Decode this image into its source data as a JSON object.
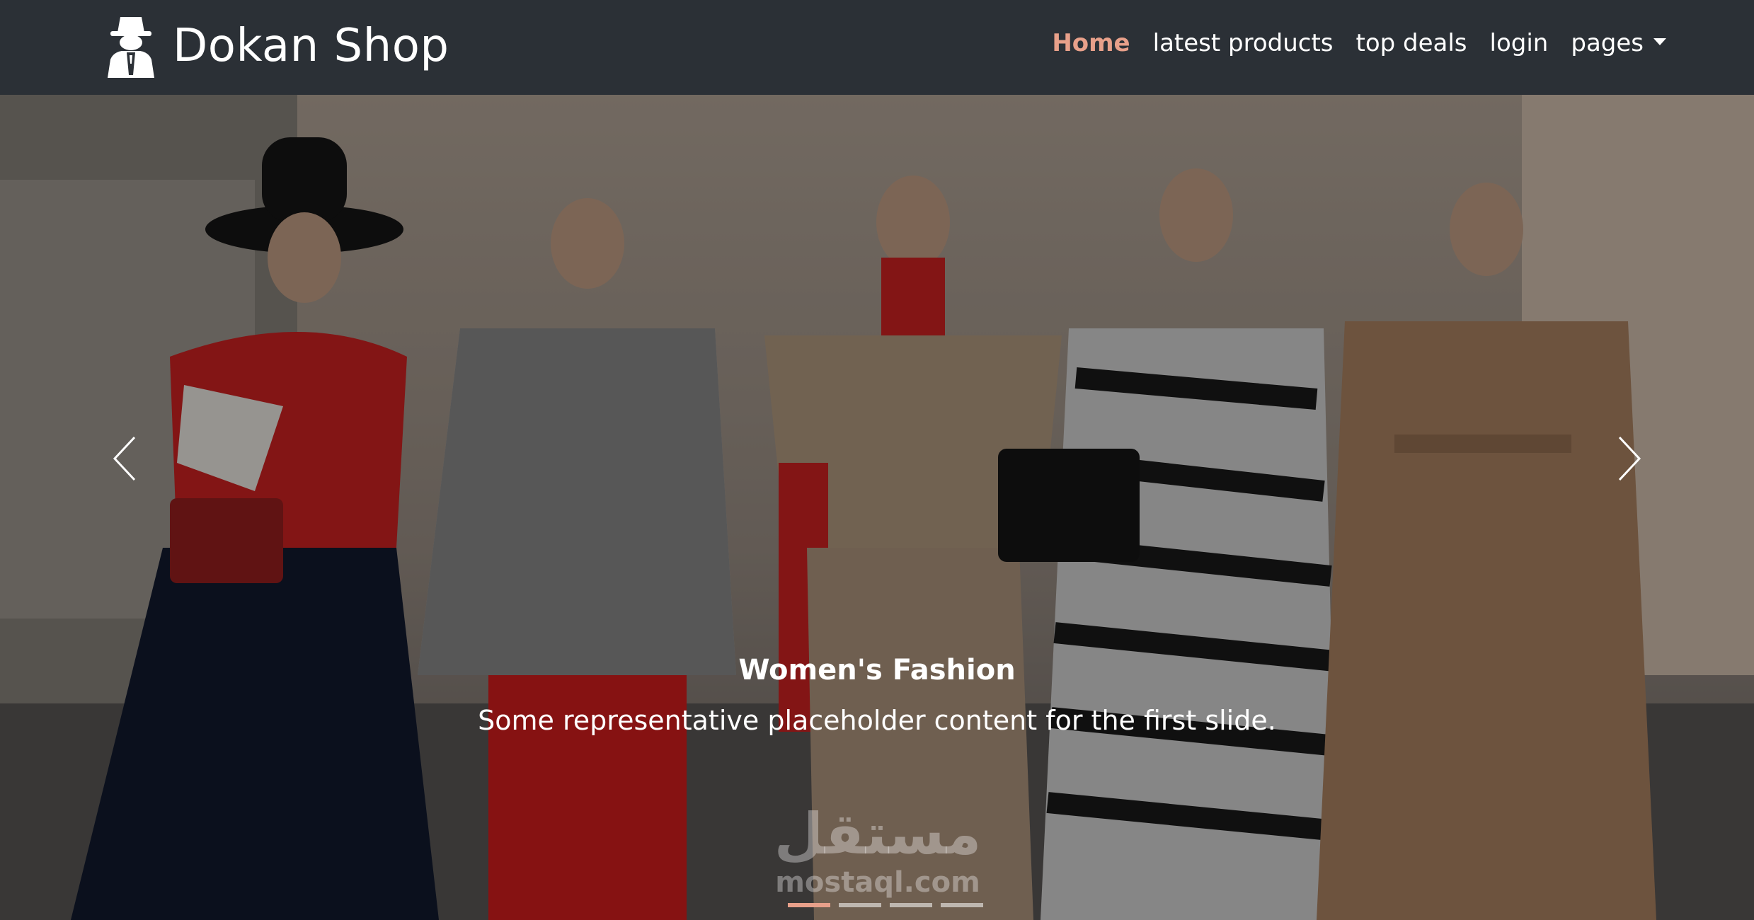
{
  "navbar": {
    "brand": "Dokan Shop",
    "brand_icon": "spy-icon",
    "links": [
      {
        "label": "Home",
        "active": true
      },
      {
        "label": "latest products",
        "active": false
      },
      {
        "label": "top deals",
        "active": false
      },
      {
        "label": "login",
        "active": false
      },
      {
        "label": "pages",
        "active": false,
        "dropdown": true
      }
    ]
  },
  "carousel": {
    "slide": {
      "title": "Women's Fashion",
      "text": "Some representative placeholder content for the first slide."
    },
    "active_index": 0,
    "indicator_count": 4
  },
  "watermark": {
    "arabic": "مستقل",
    "latin": "mostaql.com"
  },
  "colors": {
    "navbar_bg": "#2b3036",
    "active_link": "#e8a08a",
    "text": "#ffffff"
  }
}
